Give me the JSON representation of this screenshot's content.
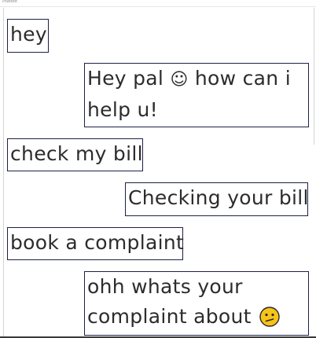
{
  "window": {
    "title": "chatbot"
  },
  "messages": [
    {
      "sender": "user",
      "text": "hey"
    },
    {
      "sender": "bot",
      "text_before": "Hey pal",
      "smile": "☺",
      "text_after": "how can i help u!"
    },
    {
      "sender": "user",
      "text": "check my bill"
    },
    {
      "sender": "bot",
      "text": "Checking your bill"
    },
    {
      "sender": "user",
      "text": "book a complaint"
    },
    {
      "sender": "bot",
      "text": "ohh whats your complaint about",
      "emoji": "confused-face-icon"
    }
  ],
  "colors": {
    "bubble_border": "#1c2147",
    "text": "#2c2c2c",
    "emoji_face": "#f7c31a",
    "emoji_outline": "#2a2a2a"
  }
}
